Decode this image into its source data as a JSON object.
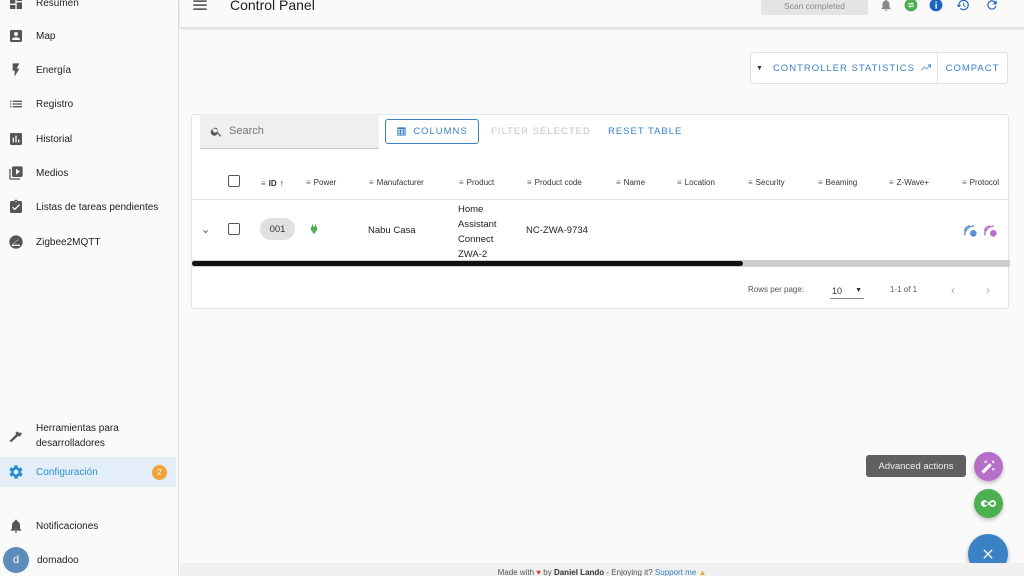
{
  "sidebar": {
    "items": [
      {
        "label": "Resumen",
        "icon": "dashboard-icon"
      },
      {
        "label": "Map",
        "icon": "map-icon"
      },
      {
        "label": "Energía",
        "icon": "lightning-icon"
      },
      {
        "label": "Registro",
        "icon": "list-icon"
      },
      {
        "label": "Historial",
        "icon": "chart-icon"
      },
      {
        "label": "Medios",
        "icon": "media-icon"
      },
      {
        "label": "Listas de tareas pendientes",
        "icon": "clipboard-icon"
      },
      {
        "label": "Zigbee2MQTT",
        "icon": "zigbee-icon"
      }
    ],
    "dev_tools": "Herramientas para desarrolladores",
    "config": {
      "label": "Configuración",
      "badge": "2"
    },
    "notifications": "Notificaciones",
    "user": {
      "initial": "d",
      "name": "domadoo"
    }
  },
  "header": {
    "title": "Control Panel",
    "scan_status": "Scan completed"
  },
  "toolbar": {
    "controller_statistics": "CONTROLLER STATISTICS",
    "compact": "COMPACT"
  },
  "table": {
    "search_placeholder": "Search",
    "columns_label": "COLUMNS",
    "filter_selected": "FILTER SELECTED",
    "reset_table": "RESET TABLE",
    "headers": {
      "id": "ID",
      "power": "Power",
      "manufacturer": "Manufacturer",
      "product": "Product",
      "product_code": "Product code",
      "name": "Name",
      "location": "Location",
      "security": "Security",
      "beaming": "Beaming",
      "zwave_plus": "Z-Wave+",
      "protocol": "Protocol"
    },
    "row": {
      "id": "001",
      "manufacturer": "Nabu Casa",
      "product_lines": [
        "Home",
        "Assistant",
        "Connect",
        "ZWA-2"
      ],
      "product_code": "NC-ZWA-9734"
    },
    "rows_per_page_label": "Rows per page:",
    "rows_per_page_value": "10",
    "range": "1-1 of 1"
  },
  "fab": {
    "tooltip": "Advanced actions"
  },
  "footer": {
    "made_with": "Made with",
    "by": "by",
    "author": "Daniel Lando",
    "enjoying": "- Enjoying it?",
    "support": "Support me"
  },
  "colors": {
    "accent": "#3b82c4",
    "badge": "#f0a23b",
    "fab_purple": "#b56fc9",
    "fab_green": "#4caf50",
    "power_green": "#4caf50"
  }
}
